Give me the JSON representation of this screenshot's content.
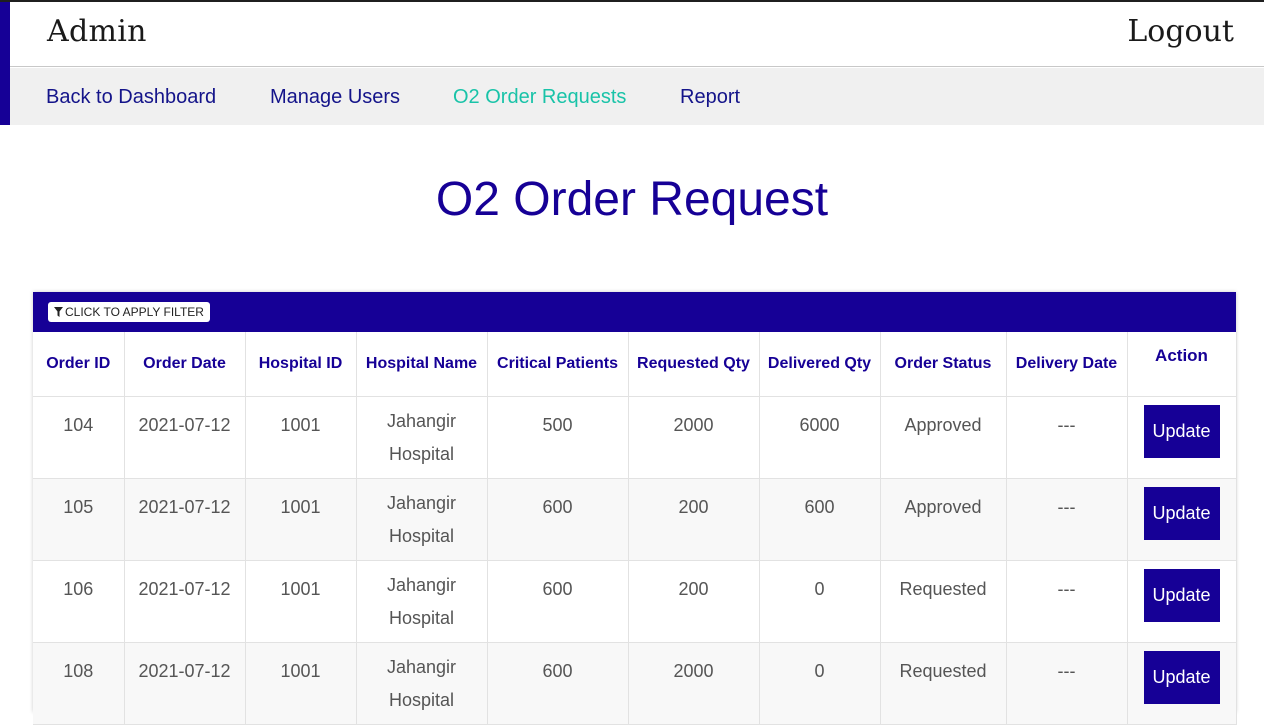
{
  "header": {
    "brand": "Admin",
    "logout": "Logout"
  },
  "nav": {
    "items": [
      {
        "label": "Back to Dashboard"
      },
      {
        "label": "Manage Users"
      },
      {
        "label": "O2 Order Requests"
      },
      {
        "label": "Report"
      }
    ],
    "active_color": "#19c3a8"
  },
  "page": {
    "title": "O2 Order Request"
  },
  "table": {
    "filter_label": "CLICK TO APPLY FILTER",
    "columns": [
      "Order ID",
      "Order Date",
      "Hospital ID",
      "Hospital Name",
      "Critical Patients",
      "Requested Qty",
      "Delivered Qty",
      "Order Status",
      "Delivery Date",
      "Action"
    ],
    "rows": [
      {
        "order_id": "104",
        "order_date": "2021-07-12",
        "hospital_id": "1001",
        "hospital_name": "Jahangir Hospital",
        "critical_patients": "500",
        "requested_qty": "2000",
        "delivered_qty": "6000",
        "order_status": "Approved",
        "delivery_date": "---",
        "action": "Update"
      },
      {
        "order_id": "105",
        "order_date": "2021-07-12",
        "hospital_id": "1001",
        "hospital_name": "Jahangir Hospital",
        "critical_patients": "600",
        "requested_qty": "200",
        "delivered_qty": "600",
        "order_status": "Approved",
        "delivery_date": "---",
        "action": "Update"
      },
      {
        "order_id": "106",
        "order_date": "2021-07-12",
        "hospital_id": "1001",
        "hospital_name": "Jahangir Hospital",
        "critical_patients": "600",
        "requested_qty": "200",
        "delivered_qty": "0",
        "order_status": "Requested",
        "delivery_date": "---",
        "action": "Update"
      },
      {
        "order_id": "108",
        "order_date": "2021-07-12",
        "hospital_id": "1001",
        "hospital_name": "Jahangir Hospital",
        "critical_patients": "600",
        "requested_qty": "2000",
        "delivered_qty": "0",
        "order_status": "Requested",
        "delivery_date": "---",
        "action": "Update"
      }
    ]
  },
  "colors": {
    "primary": "#160096",
    "nav_text": "#14148a",
    "active_nav": "#19c3a8"
  },
  "icons": {
    "filter": "filter-icon"
  }
}
